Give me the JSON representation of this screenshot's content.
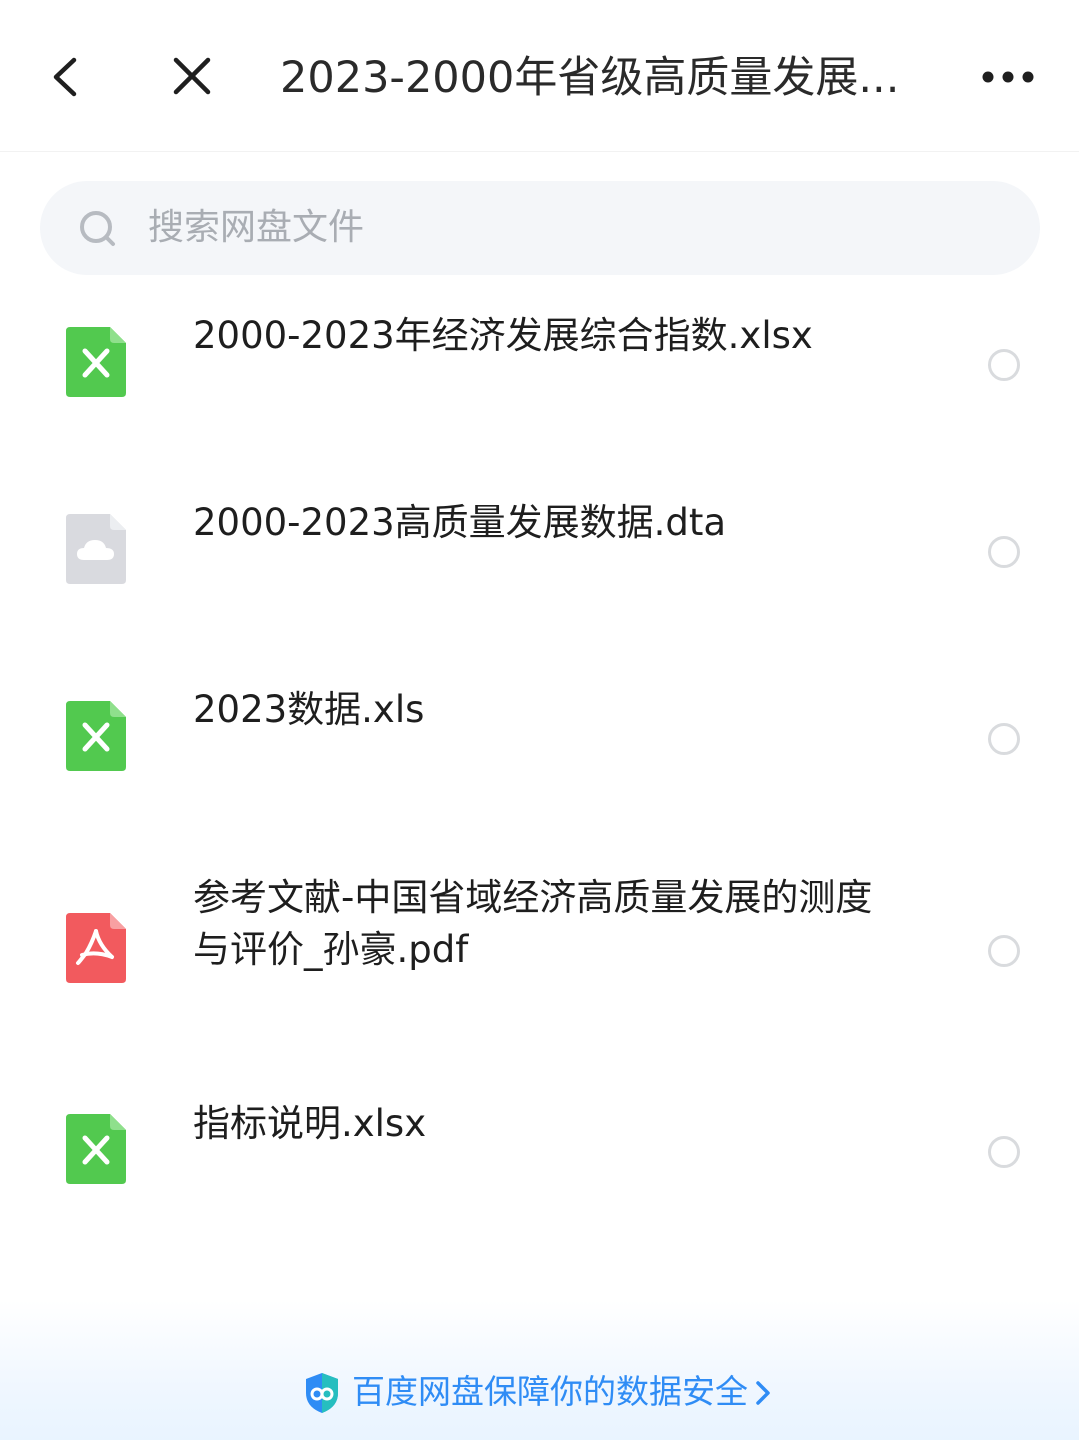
{
  "header": {
    "title": "2023-2000年省级高质量发展...",
    "back_icon": "chevron-left-icon",
    "close_icon": "close-icon",
    "more_icon": "more-dots-icon"
  },
  "search": {
    "placeholder": "搜索网盘文件",
    "icon": "search-icon"
  },
  "files": [
    {
      "name": "2000-2023年经济发展综合指数.xlsx",
      "icon": "excel-file-icon",
      "color": "#52c94f"
    },
    {
      "name": "2000-2023高质量发展数据.dta",
      "icon": "cloud-file-icon",
      "color": "#d9dadf"
    },
    {
      "name": "2023数据.xls",
      "icon": "excel-file-icon",
      "color": "#52c94f"
    },
    {
      "name_line1": "参考文献-中国省域经济高质量发展的测度",
      "name_line2": "与评价_孙豪.pdf",
      "icon": "pdf-file-icon",
      "color": "#f25a5e"
    },
    {
      "name": "指标说明.xlsx",
      "icon": "excel-file-icon",
      "color": "#52c94f"
    }
  ],
  "footer": {
    "text": "百度网盘保障你的数据安全",
    "icon": "shield-icon",
    "accent": "#2f8cf5"
  }
}
